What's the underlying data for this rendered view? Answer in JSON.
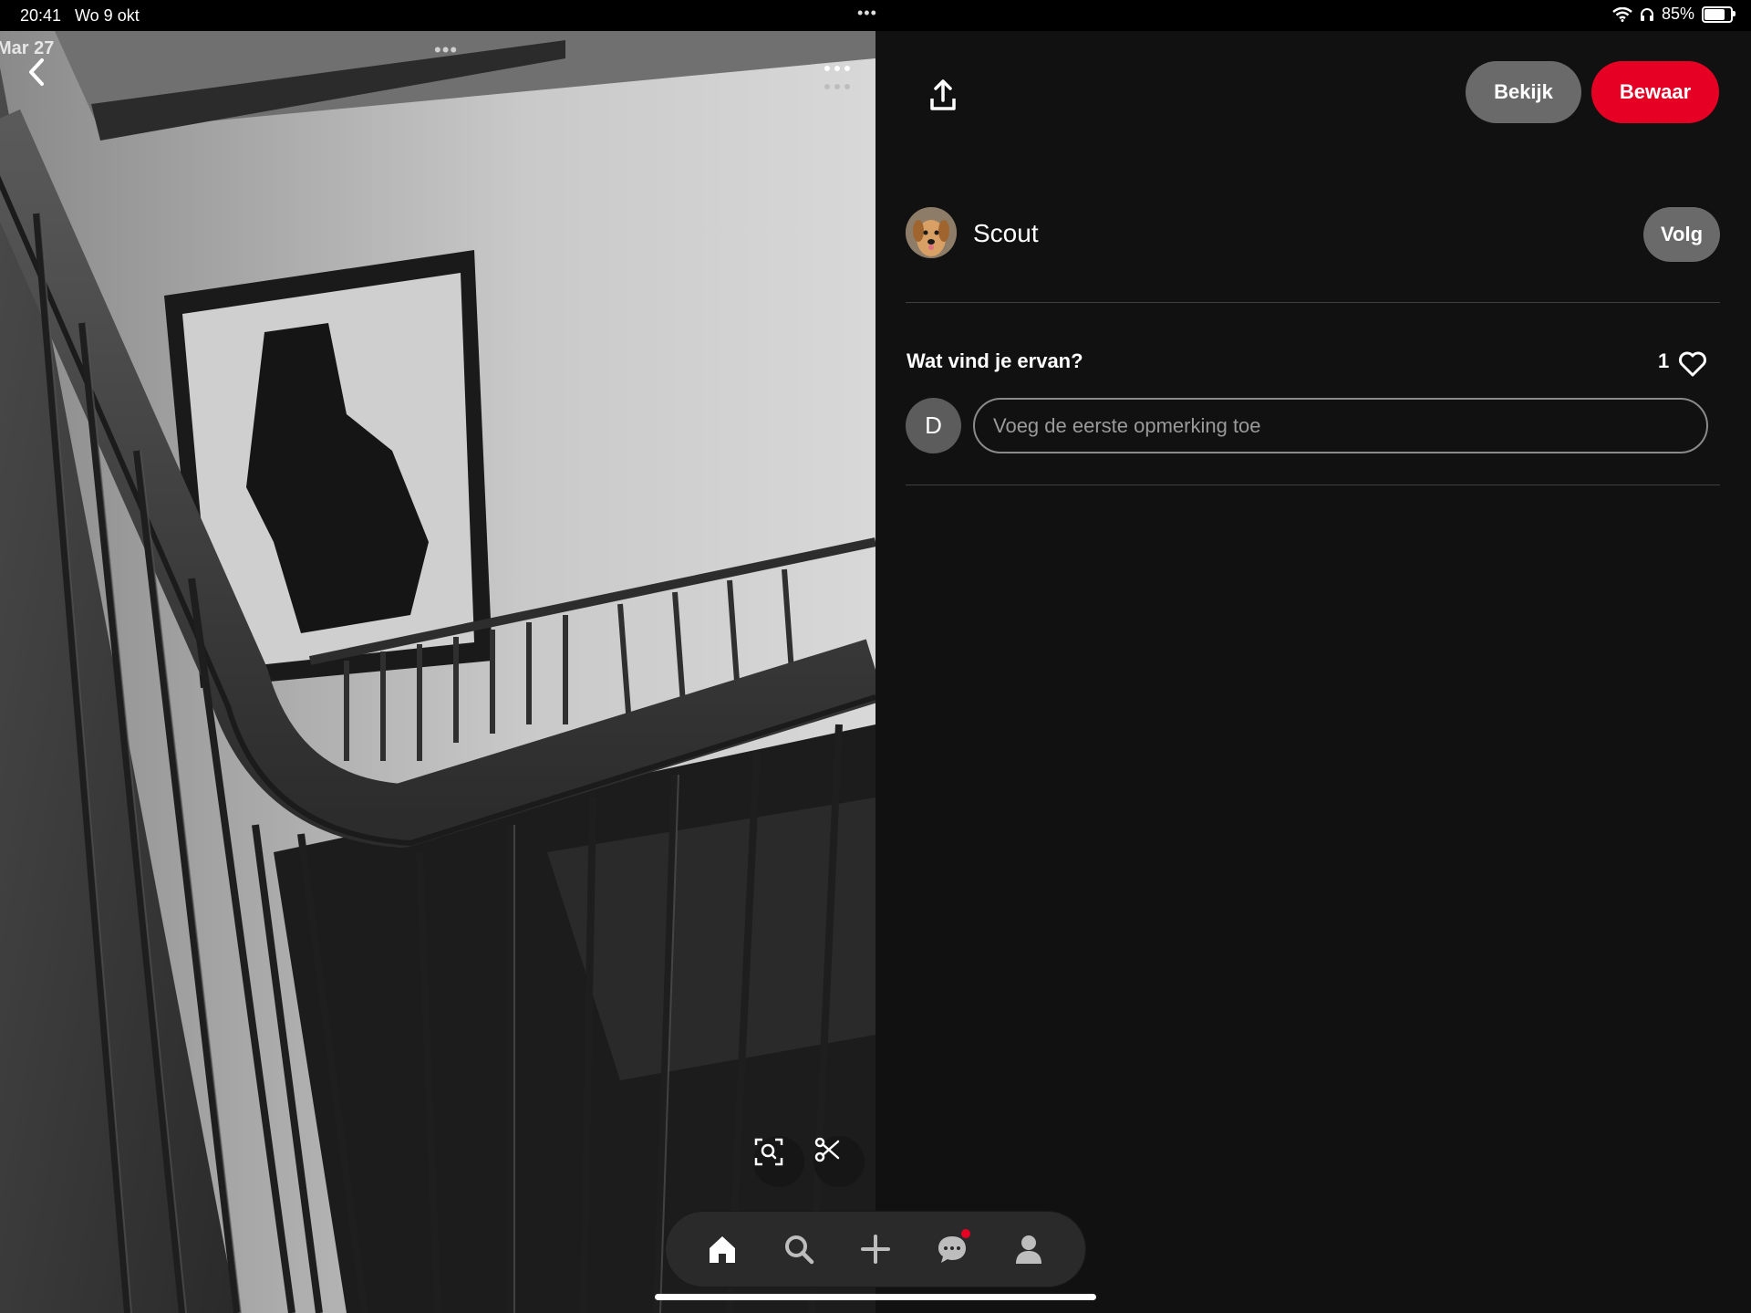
{
  "status_bar": {
    "time": "20:41",
    "date": "Wo 9 okt",
    "battery_percent": "85%",
    "battery_level": 0.85,
    "center_dots": "•••"
  },
  "photo": {
    "date_label": "Mar 27",
    "top_dots": "•••"
  },
  "header": {
    "bekijk_label": "Bekijk",
    "bewaar_label": "Bewaar"
  },
  "creator": {
    "name": "Scout",
    "follow_label": "Volg"
  },
  "comments": {
    "title": "Wat vind je ervan?",
    "like_count": "1",
    "user_initial": "D",
    "input_placeholder": "Voeg de eerste opmerking toe",
    "input_value": ""
  },
  "bottom_nav": {
    "items": [
      "home-icon",
      "search-icon",
      "plus-icon",
      "chat-icon",
      "profile-icon"
    ],
    "active": "home-icon",
    "notification_on": "chat-icon"
  },
  "colors": {
    "accent": "#e60023",
    "background": "#111111",
    "secondary_button": "#6a6a6a"
  }
}
